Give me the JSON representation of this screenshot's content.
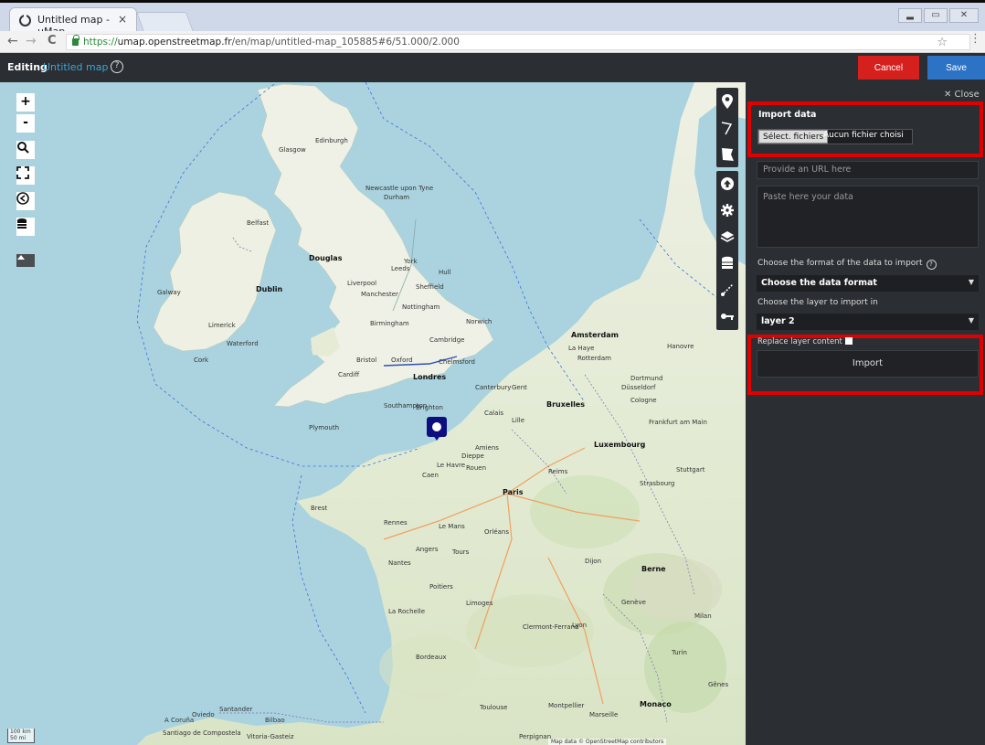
{
  "browser": {
    "tab_title": "Untitled map - uMap",
    "tab_close": "×",
    "nav_back": "←",
    "nav_forward": "→",
    "nav_reload": "C",
    "url_scheme": "https://",
    "url_host": "umap.openstreetmap.fr",
    "url_path": "/en/map/untitled-map_105885#6/51.000/2.000",
    "star": "☆",
    "menu": "⋮",
    "window_controls": [
      "▂",
      "▭",
      "✕"
    ]
  },
  "header": {
    "editing_label": "Editing",
    "map_name": "Untitled map",
    "help": "?",
    "cancel_label": "Cancel",
    "save_label": "Save"
  },
  "map": {
    "zoom_in": "+",
    "zoom_out": "-",
    "scale_km": "100 km",
    "scale_mi": "50 mi",
    "attribution": "Map data © OpenStreetMap contributors",
    "places": {
      "dublin": "Dublin",
      "belfast": "Belfast",
      "edinburgh": "Edinburgh",
      "glasgow": "Glasgow",
      "newcastle": "Newcastle upon Tyne",
      "durham": "Durham",
      "douglas": "Douglas",
      "york": "York",
      "leeds": "Leeds",
      "hull": "Hull",
      "liverpool": "Liverpool",
      "manchester": "Manchester",
      "sheffield": "Sheffield",
      "nottingham": "Nottingham",
      "birmingham": "Birmingham",
      "norwich": "Norwich",
      "cambridge": "Cambridge",
      "oxford": "Oxford",
      "londres": "Londres",
      "chelmsford": "Chelmsford",
      "cardiff": "Cardiff",
      "bristol": "Bristol",
      "plymouth": "Plymouth",
      "southampton": "Southampton",
      "brighton": "Brighton",
      "canterbury": "Canterbury",
      "cork": "Cork",
      "limerick": "Limerick",
      "waterford": "Waterford",
      "galway": "Galway",
      "amsterdam": "Amsterdam",
      "lahaye": "La Haye",
      "rotterdam": "Rotterdam",
      "bruxelles": "Bruxelles",
      "cologne": "Cologne",
      "dusseldorf": "Düsseldorf",
      "dortmund": "Dortmund",
      "luxembourg": "Luxembourg",
      "paris": "Paris",
      "reims": "Reims",
      "rouen": "Rouen",
      "caen": "Caen",
      "lemans": "Le Mans",
      "rennes": "Rennes",
      "brest": "Brest",
      "nantes": "Nantes",
      "tours": "Tours",
      "orleans": "Orléans",
      "angers": "Angers",
      "poitiers": "Poitiers",
      "limoges": "Limoges",
      "bordeaux": "Bordeaux",
      "larochelle": "La Rochelle",
      "clermont": "Clermont-Ferrand",
      "lyon": "Lyon",
      "dijon": "Dijon",
      "strasbourg": "Strasbourg",
      "berne": "Berne",
      "geneve": "Genève",
      "toulouse": "Toulouse",
      "montpellier": "Montpellier",
      "marseille": "Marseille",
      "monaco": "Monaco",
      "genes": "Gênes",
      "turin": "Turin",
      "milan": "Milan",
      "stuttgart": "Stuttgart",
      "frankfurt": "Frankfurt am Main",
      "hanovre": "Hanovre",
      "bilbao": "Bilbao",
      "santander": "Santander",
      "oviedo": "Oviedo",
      "acoruna": "A Coruña",
      "santiago": "Santiago de Compostela",
      "vitoria": "Vitoria-Gasteiz",
      "perpignan": "Perpignan",
      "gent": "Gent",
      "lille": "Lille",
      "amiens": "Amiens",
      "lehavre": "Le Havre",
      "dieppe": "Dieppe",
      "calais": "Calais"
    }
  },
  "panel": {
    "close_label": "✕ Close",
    "import_title": "Import data",
    "file_button": "Sélect. fichiers",
    "file_status": "Aucun fichier choisi",
    "url_placeholder": "Provide an URL here",
    "paste_placeholder": "Paste here your data",
    "format_label": "Choose the format of the data to import",
    "format_value": "Choose the data format",
    "layer_label": "Choose the layer to import in",
    "layer_value": "layer 2",
    "replace_label": "Replace layer content",
    "import_button": "Import"
  },
  "colors": {
    "sea": "#aad3df",
    "land": "#f1eee8",
    "panel_bg": "#2b2e32",
    "cancel": "#d6201e",
    "save": "#2c73c6",
    "highlight": "#e00000",
    "marker": "#0d0f80"
  }
}
